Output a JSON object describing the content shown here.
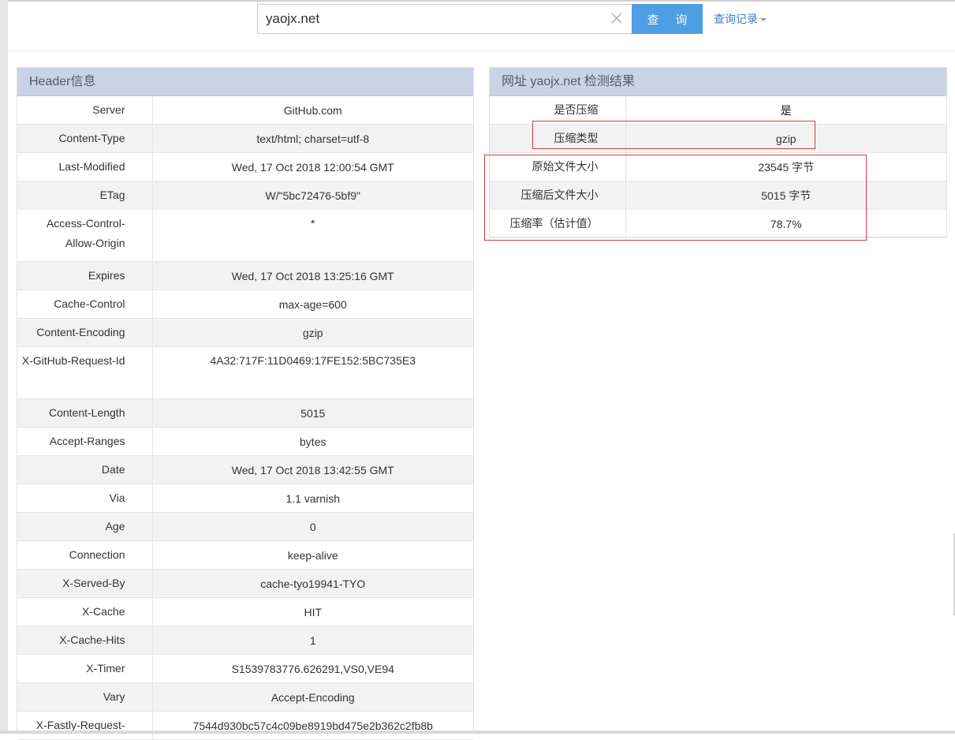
{
  "search": {
    "value": "yaojx.net",
    "button_label": "查 询",
    "history_label": "查询记录"
  },
  "header_panel": {
    "title": "Header信息",
    "rows": [
      {
        "key": "Server",
        "value": "GitHub.com"
      },
      {
        "key": "Content-Type",
        "value": "text/html; charset=utf-8"
      },
      {
        "key": "Last-Modified",
        "value": "Wed, 17 Oct 2018 12:00:54 GMT"
      },
      {
        "key": "ETag",
        "value": "W/\"5bc72476-5bf9\""
      },
      {
        "key": "Access-Control-Allow-Origin",
        "value": "*"
      },
      {
        "key": "Expires",
        "value": "Wed, 17 Oct 2018 13:25:16 GMT"
      },
      {
        "key": "Cache-Control",
        "value": "max-age=600"
      },
      {
        "key": "Content-Encoding",
        "value": "gzip"
      },
      {
        "key": "X-GitHub-Request-Id",
        "value": "4A32:717F:11D0469:17FE152:5BC735E3"
      },
      {
        "key": "Content-Length",
        "value": "5015"
      },
      {
        "key": "Accept-Ranges",
        "value": "bytes"
      },
      {
        "key": "Date",
        "value": "Wed, 17 Oct 2018 13:42:55 GMT"
      },
      {
        "key": "Via",
        "value": "1.1 varnish"
      },
      {
        "key": "Age",
        "value": "0"
      },
      {
        "key": "Connection",
        "value": "keep-alive"
      },
      {
        "key": "X-Served-By",
        "value": "cache-tyo19941-TYO"
      },
      {
        "key": "X-Cache",
        "value": "HIT"
      },
      {
        "key": "X-Cache-Hits",
        "value": "1"
      },
      {
        "key": "X-Timer",
        "value": "S1539783776.626291,VS0,VE94"
      },
      {
        "key": "Vary",
        "value": "Accept-Encoding"
      },
      {
        "key": "X-Fastly-Request-",
        "value": "7544d930bc57c4c09be8919bd475e2b362c2fb8b"
      }
    ]
  },
  "result_panel": {
    "title": "网址 yaojx.net 检测结果",
    "rows": [
      {
        "key": "是否压缩",
        "value": "是"
      },
      {
        "key": "压缩类型",
        "value": "gzip"
      },
      {
        "key": "原始文件大小",
        "value": "23545 字节"
      },
      {
        "key": "压缩后文件大小",
        "value": "5015 字节"
      },
      {
        "key": "压缩率（估计值）",
        "value": "78.7%"
      }
    ]
  },
  "colors": {
    "accent": "#4d9ee3",
    "link": "#3b7ccb",
    "panel_header": "#c9d3e5",
    "highlight_box": "#d43b3b"
  },
  "icons": {
    "clear": "close-icon",
    "dropdown": "caret-down-icon"
  }
}
